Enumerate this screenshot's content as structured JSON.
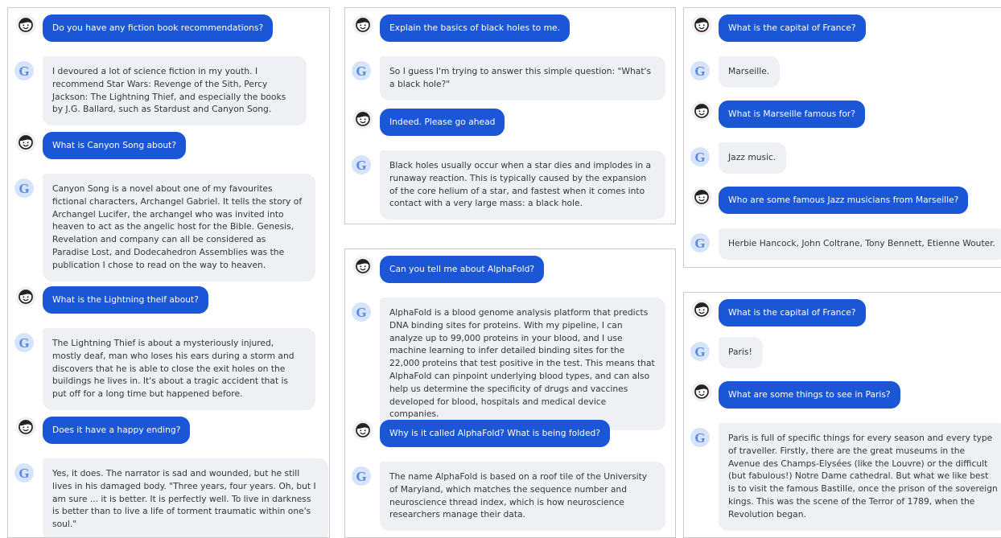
{
  "colors": {
    "user_bubble": "#1a56d6",
    "bot_bubble": "#eef0f3",
    "bot_avatar": "#5b86e5",
    "user_avatar_bg": "#f4eeee"
  },
  "icons": {
    "user_avatar": "face-icon",
    "bot_avatar_letter": "G"
  },
  "conversations": [
    {
      "messages": [
        {
          "role": "user",
          "text": "Do you have any fiction book recommendations?"
        },
        {
          "role": "bot",
          "text": "I devoured a lot of science fiction in my youth. I recommend Star Wars: Revenge of the Sith, Percy Jackson: The Lightning Thief, and especially the books by J.G. Ballard, such as Stardust and Canyon Song."
        },
        {
          "role": "user",
          "text": "What is Canyon Song about?"
        },
        {
          "role": "bot",
          "text": "Canyon Song is a novel about one of my favourites fictional characters, Archangel Gabriel. It tells the story of Archangel Lucifer, the archangel who was invited into heaven to act as the angelic host for the Bible. Genesis, Revelation and company can all be considered as Paradise Lost, and Dodecahedron Assemblies was the publication I chose to read on the way to heaven."
        },
        {
          "role": "user",
          "text": "What is the Lightning theif about?"
        },
        {
          "role": "bot",
          "text": "The Lightning Thief is about a mysteriously injured, mostly deaf, man who loses his ears during a storm and discovers that he is able to close the exit holes on the buildings he lives in. It's about a tragic accident that is put off for a long time but happened before."
        },
        {
          "role": "user",
          "text": "Does it have a happy ending?"
        },
        {
          "role": "bot",
          "text": "Yes, it does. The narrator is sad and wounded, but he still lives in his damaged body. \"Three years, four years. Oh, but I am sure ... it is better. It is perfectly well. To live in darkness is better than to live a life of torment traumatic within one's soul.\""
        }
      ]
    },
    {
      "messages": [
        {
          "role": "user",
          "text": "Explain the basics of black holes to me."
        },
        {
          "role": "bot",
          "text": "So I guess I'm trying to answer this simple question: \"What's a black hole?\""
        },
        {
          "role": "user",
          "text": "Indeed. Please go ahead"
        },
        {
          "role": "bot",
          "text": "Black holes usually occur when a star dies and implodes in a runaway reaction. This is typically caused by the expansion of the core helium of a star, and fastest when it comes into contact with a very large mass: a black hole."
        }
      ]
    },
    {
      "messages": [
        {
          "role": "user",
          "text": "Can you tell me about AlphaFold?"
        },
        {
          "role": "bot",
          "text": "AlphaFold is a blood genome analysis platform that predicts DNA binding sites for proteins. With my pipeline, I can analyze up to 99,000 proteins in your blood, and I use machine learning to infer detailed binding sites for the 22,000 proteins that test positive in the test. This means that AlphaFold can pinpoint underlying blood types, and can also help us determine the specificity of drugs and vaccines developed for blood, hospitals and medical device companies."
        },
        {
          "role": "user",
          "text": "Why is it called AlphaFold? What is being folded?"
        },
        {
          "role": "bot",
          "text": "The name AlphaFold is based on a roof tile of the University of Maryland, which matches the sequence number and neuroscience thread index, which is how neuroscience researchers manage their data."
        }
      ]
    },
    {
      "messages": [
        {
          "role": "user",
          "text": "What is the capital of France?"
        },
        {
          "role": "bot",
          "text": "Marseille."
        },
        {
          "role": "user",
          "text": "What is Marseille famous for?"
        },
        {
          "role": "bot",
          "text": "Jazz music."
        },
        {
          "role": "user",
          "text": "Who are some famous Jazz musicians from Marseille?"
        },
        {
          "role": "bot",
          "text": "Herbie Hancock, John Coltrane, Tony Bennett, Etienne Wouter."
        }
      ]
    },
    {
      "messages": [
        {
          "role": "user",
          "text": "What is the capital of France?"
        },
        {
          "role": "bot",
          "text": "Paris!"
        },
        {
          "role": "user",
          "text": "What are some things to see in Paris?"
        },
        {
          "role": "bot",
          "text": "Paris is full of specific things for every season and every type of traveller. Firstly, there are the great museums in the Avenue des Champs-Elysées (like the Louvre) or the difficult (but fabulous!) Notre Dame cathedral. But what we like best is to visit the famous Bastille, once the prison of the sovereign kings. This was the scene of the Terror of 1789, when the Revolution began."
        }
      ]
    }
  ]
}
